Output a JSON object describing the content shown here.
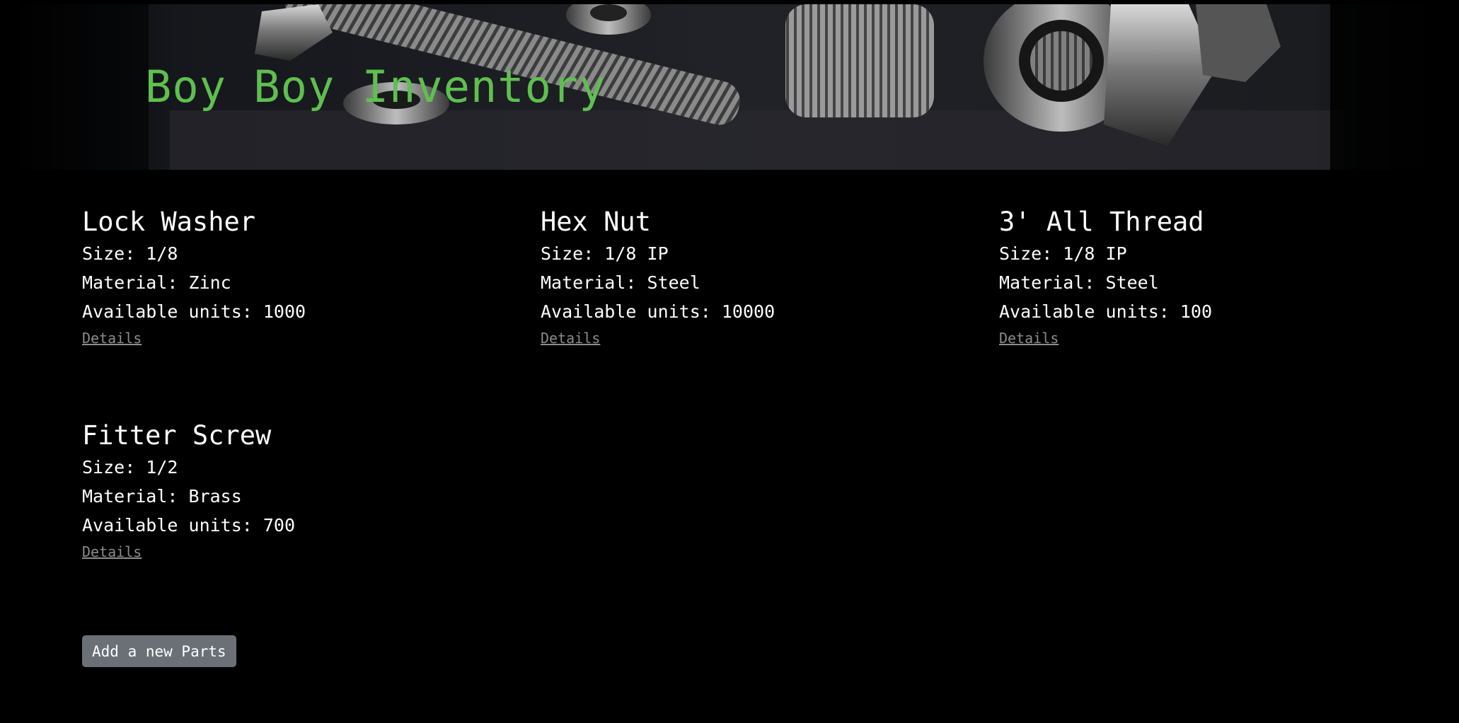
{
  "header": {
    "title": "Boy Boy Inventory",
    "image_subject": "steel bolts, nuts and washers on dark background",
    "title_color": "#5fbf4f"
  },
  "parts": [
    {
      "name": "Lock Washer",
      "size": "Size: 1/8",
      "material": "Material: Zinc",
      "units": "Available units: 1000",
      "link": "Details"
    },
    {
      "name": "Hex Nut",
      "size": "Size: 1/8 IP",
      "material": "Material: Steel",
      "units": "Available units: 10000",
      "link": "Details"
    },
    {
      "name": "3' All Thread",
      "size": "Size: 1/8 IP",
      "material": "Material: Steel",
      "units": "Available units: 100",
      "link": "Details"
    },
    {
      "name": "Fitter Screw",
      "size": "Size: 1/2",
      "material": "Material: Brass",
      "units": "Available units: 700",
      "link": "Details"
    }
  ],
  "actions": {
    "add_label": "Add a new Parts"
  },
  "colors": {
    "background": "#000000",
    "text": "#ffffff",
    "link": "#8c8c8c",
    "button": "#6b7077"
  }
}
